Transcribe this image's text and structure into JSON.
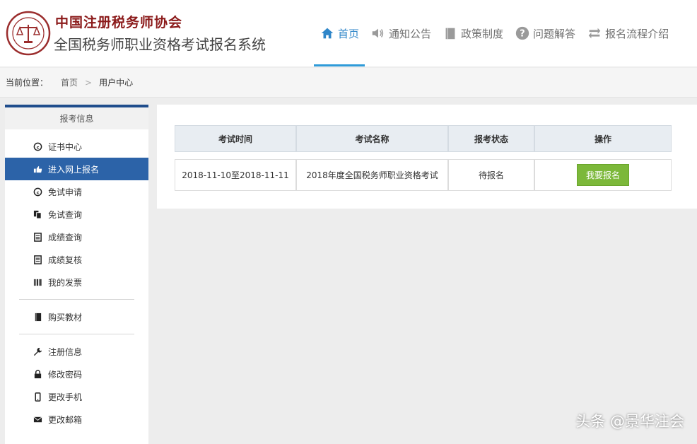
{
  "header": {
    "logo_text": "中国注册税务师协会",
    "site_title": "全国税务师职业资格考试报名系统",
    "nav": [
      {
        "label": "首页",
        "icon": "home-icon",
        "active": true
      },
      {
        "label": "通知公告",
        "icon": "speaker-icon",
        "active": false
      },
      {
        "label": "政策制度",
        "icon": "book-icon",
        "active": false
      },
      {
        "label": "问题解答",
        "icon": "question-icon",
        "active": false
      },
      {
        "label": "报名流程介绍",
        "icon": "flow-icon",
        "active": false
      }
    ],
    "colors": {
      "active": "#2f86c9",
      "brand": "#8b1a1a"
    }
  },
  "breadcrumb": {
    "label": "当前位置：",
    "items": [
      "首页",
      "用户中心"
    ],
    "separator": ">"
  },
  "sidebar": {
    "title": "报考信息",
    "groups": [
      [
        {
          "label": "证书中心",
          "icon": "certificate-icon"
        },
        {
          "label": "进入网上报名",
          "icon": "hand-pointer-icon",
          "active": true
        },
        {
          "label": "免试申请",
          "icon": "copyright-icon"
        },
        {
          "label": "免试查询",
          "icon": "files-icon"
        },
        {
          "label": "成绩查询",
          "icon": "list-icon"
        },
        {
          "label": "成绩复核",
          "icon": "list-icon"
        },
        {
          "label": "我的发票",
          "icon": "barcode-icon"
        }
      ],
      [
        {
          "label": "购买教材",
          "icon": "book-icon"
        }
      ],
      [
        {
          "label": "注册信息",
          "icon": "wrench-icon"
        },
        {
          "label": "修改密码",
          "icon": "lock-icon"
        },
        {
          "label": "更改手机",
          "icon": "mobile-icon"
        },
        {
          "label": "更改邮箱",
          "icon": "envelope-icon"
        }
      ]
    ],
    "active_color": "#2c63a8"
  },
  "table": {
    "headers": [
      "考试时间",
      "考试名称",
      "报考状态",
      "操作"
    ],
    "rows": [
      {
        "time": "2018-11-10至2018-11-11",
        "name": "2018年度全国税务师职业资格考试",
        "status": "待报名",
        "action": "我要报名"
      }
    ],
    "button_color": "#7cb83a"
  },
  "watermark": "头条 @景华注会"
}
